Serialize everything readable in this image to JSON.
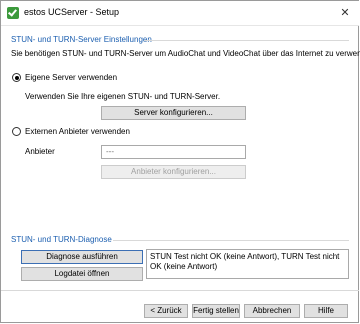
{
  "window": {
    "title": "estos UCServer - Setup"
  },
  "stun_section": {
    "heading": "STUN- und TURN-Server Einstellungen",
    "description": "Sie benötigen STUN- und TURN-Server um AudioChat und VideoChat über das Internet zu verwenden"
  },
  "own_server": {
    "option_label": "Eigene Server verwenden",
    "option_checked": true,
    "hint": "Verwenden Sie Ihre eigenen STUN- und TURN-Server.",
    "configure_button": "Server konfigurieren..."
  },
  "external_provider": {
    "option_label": "Externen Anbieter verwenden",
    "option_checked": false,
    "provider_label": "Anbieter",
    "provider_value": "---",
    "configure_button": "Anbieter konfigurieren..."
  },
  "diagnosis": {
    "heading": "STUN- und TURN-Diagnose",
    "run_button": "Diagnose ausführen",
    "logfile_button": "Logdatei öffnen",
    "result_text": "STUN Test nicht OK (keine Antwort), TURN Test nicht OK (keine Antwort)"
  },
  "footer": {
    "back_button": "< Zurück",
    "finish_button": "Fertig stellen",
    "cancel_button": "Abbrechen",
    "help_button": "Hilfe"
  },
  "colors": {
    "section_heading": "#1c5fb0",
    "app_icon": "#3c9a3c"
  }
}
